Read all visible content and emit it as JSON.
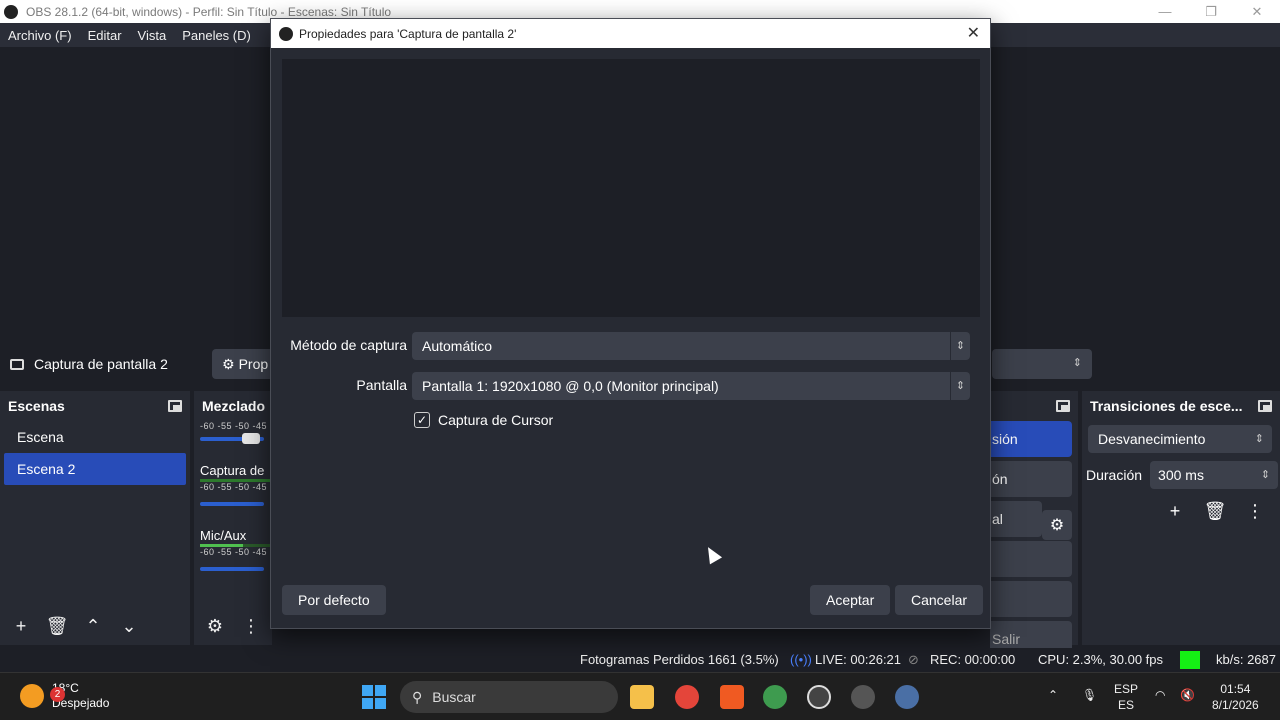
{
  "window": {
    "title": "OBS 28.1.2 (64-bit, windows) - Perfil: Sin Título - Escenas: Sin Título",
    "controls": [
      "—",
      "❐",
      "✕"
    ]
  },
  "menu": [
    "Archivo (F)",
    "Editar",
    "Vista",
    "Paneles (D)"
  ],
  "source_row": {
    "source_name": "Captura de pantalla 2",
    "props_label": "Prop"
  },
  "scenes": {
    "title": "Escenas",
    "items": [
      {
        "label": "Escena",
        "active": false
      },
      {
        "label": "Escena 2",
        "active": true
      }
    ]
  },
  "mixer": {
    "title": "Mezclado",
    "scale": "-60 -55 -50 -45",
    "items": [
      {
        "label": "Captura de"
      },
      {
        "label": "Mic/Aux"
      }
    ]
  },
  "controls": {
    "buttons": [
      "sión",
      "ón",
      "al",
      "",
      "",
      "Salir"
    ]
  },
  "transitions": {
    "title": "Transiciones de esce...",
    "selected": "Desvanecimiento",
    "duration_label": "Duración",
    "duration_value": "300 ms"
  },
  "statusbar": {
    "dropped": "Fotogramas Perdidos 1661 (3.5%)",
    "live": "LIVE: 00:26:21",
    "rec": "REC: 00:00:00",
    "cpu": "CPU: 2.3%, 30.00 fps",
    "kbs": "kb/s: 2687",
    "status_color": "#15ef15"
  },
  "dialog": {
    "title": "Propiedades para 'Captura de pantalla 2'",
    "method_label": "Método de captura",
    "method_value": "Automático",
    "screen_label": "Pantalla",
    "screen_value": "Pantalla 1: 1920x1080 @ 0,0 (Monitor principal)",
    "cursor_label": "Captura de Cursor",
    "cursor_checked": true,
    "defaults_button": "Por defecto",
    "accept_button": "Aceptar",
    "cancel_button": "Cancelar"
  },
  "taskbar": {
    "weather_badge": "2",
    "temperature": "18°C",
    "condition": "Despejado",
    "search_placeholder": "Buscar",
    "lang_top": "ESP",
    "lang_bottom": "ES",
    "time": "01:54",
    "date": "8/1/2026",
    "chrome_badge": "S"
  }
}
